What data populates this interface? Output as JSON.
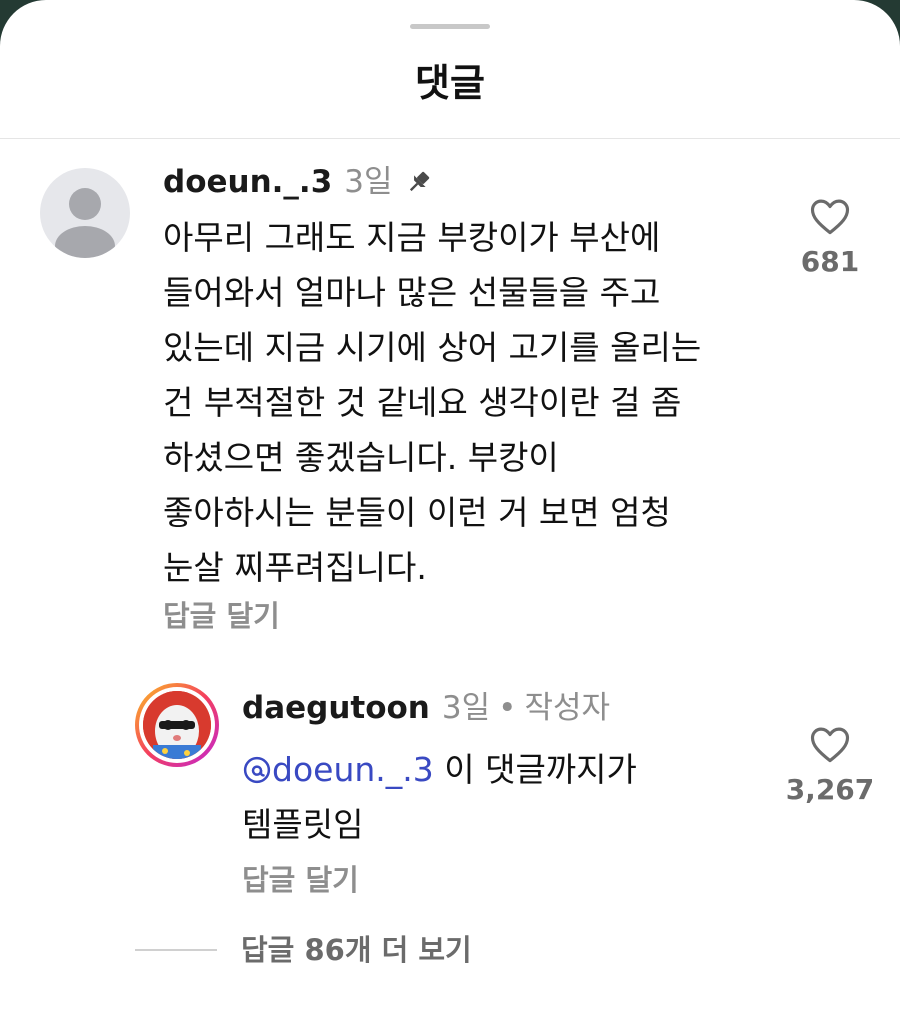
{
  "sheet": {
    "title": "댓글"
  },
  "comments": [
    {
      "username": "doeun._.3",
      "time": "3일",
      "pinned": true,
      "text": "아무리 그래도 지금 부캉이가 부산에\n들어와서 얼마나 많은 선물들을 주고\n있는데 지금 시기에 상어 고기를 올리는\n건 부적절한 것 같네요 생각이란 걸 좀\n하셨으면 좋겠습니다. 부캉이\n좋아하시는 분들이 이런 거 보면 엄청\n눈살 찌푸려집니다.",
      "reply_label": "답글 달기",
      "like_count": "681",
      "avatar": "default-avatar-icon",
      "replies": [
        {
          "username": "daegutoon",
          "time": "3일",
          "separator": "•",
          "badge": "작성자",
          "mention_icon": "threads-at-icon",
          "mention": "doeun._.3",
          "text_after_mention": " 이 댓글까지가\n템플릿임",
          "reply_label": "답글 달기",
          "like_count": "3,267",
          "avatar": "cartoon-avatar"
        }
      ],
      "view_more_label": "답글 86개 더 보기"
    }
  ],
  "colors": {
    "background_outer": "#243a33",
    "sheet": "#ffffff",
    "text_primary": "#111111",
    "text_secondary": "#8e8e8e",
    "mention": "#3949c2",
    "story_ring_start": "#fbbf24",
    "story_ring_end": "#c026d3"
  }
}
